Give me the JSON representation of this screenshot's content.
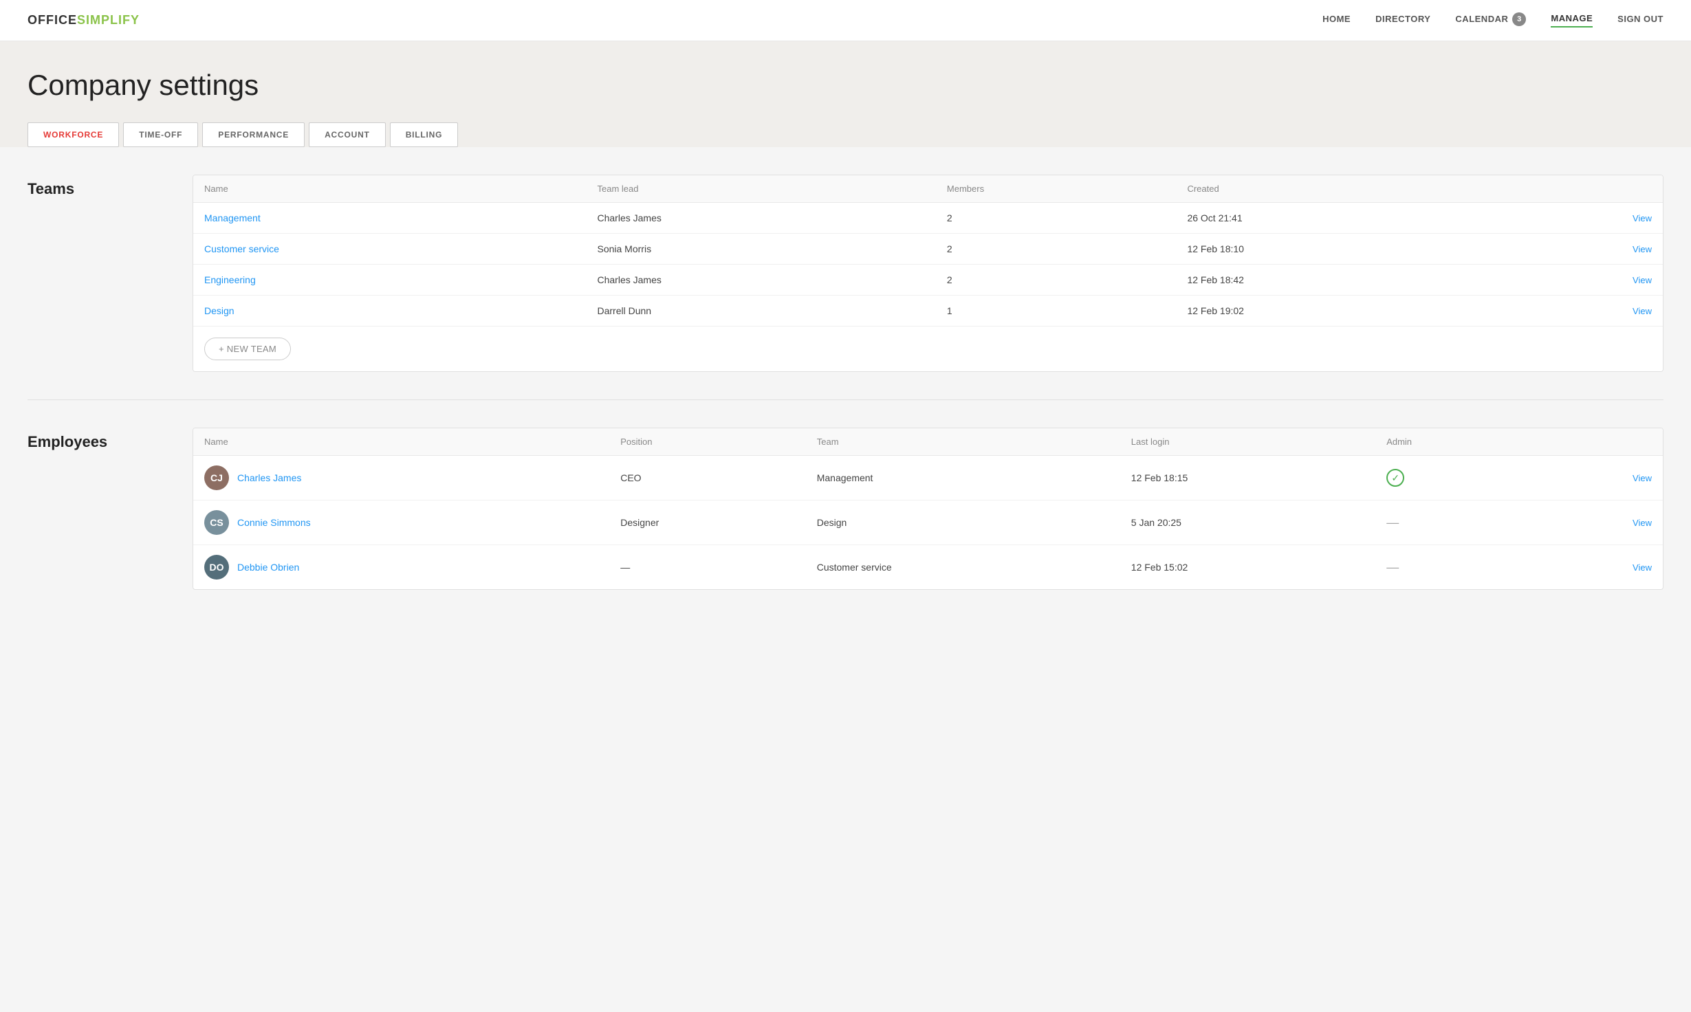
{
  "logo": {
    "office": "OFFICE",
    "simplify": "SIMPLIFY"
  },
  "nav": {
    "links": [
      {
        "label": "HOME",
        "active": false
      },
      {
        "label": "DIRECTORY",
        "active": false
      },
      {
        "label": "CALENDAR",
        "active": false,
        "badge": "3"
      },
      {
        "label": "MANAGE",
        "active": true
      },
      {
        "label": "SIGN OUT",
        "active": false
      }
    ]
  },
  "page": {
    "title": "Company settings"
  },
  "tabs": [
    {
      "label": "WORKFORCE",
      "active": true
    },
    {
      "label": "TIME-OFF",
      "active": false
    },
    {
      "label": "PERFORMANCE",
      "active": false
    },
    {
      "label": "ACCOUNT",
      "active": false
    },
    {
      "label": "BILLING",
      "active": false
    }
  ],
  "teams": {
    "section_label": "Teams",
    "columns": [
      "Name",
      "Team lead",
      "Members",
      "Created"
    ],
    "rows": [
      {
        "name": "Management",
        "lead": "Charles James",
        "members": "2",
        "created": "26 Oct 21:41"
      },
      {
        "name": "Customer service",
        "lead": "Sonia Morris",
        "members": "2",
        "created": "12 Feb 18:10"
      },
      {
        "name": "Engineering",
        "lead": "Charles James",
        "members": "2",
        "created": "12 Feb 18:42"
      },
      {
        "name": "Design",
        "lead": "Darrell Dunn",
        "members": "1",
        "created": "12 Feb 19:02"
      }
    ],
    "new_team_btn": "+ NEW TEAM"
  },
  "employees": {
    "section_label": "Employees",
    "columns": [
      "Name",
      "Position",
      "Team",
      "Last login",
      "Admin"
    ],
    "rows": [
      {
        "name": "Charles James",
        "position": "CEO",
        "team": "Management",
        "last_login": "12 Feb 18:15",
        "is_admin": true,
        "initials": "CJ",
        "av_class": "av-charles"
      },
      {
        "name": "Connie Simmons",
        "position": "Designer",
        "team": "Design",
        "last_login": "5 Jan 20:25",
        "is_admin": false,
        "initials": "CS",
        "av_class": "av-connie"
      },
      {
        "name": "Debbie Obrien",
        "position": "—",
        "team": "Customer service",
        "last_login": "12 Feb 15:02",
        "is_admin": false,
        "initials": "DO",
        "av_class": "av-debbie"
      }
    ]
  }
}
